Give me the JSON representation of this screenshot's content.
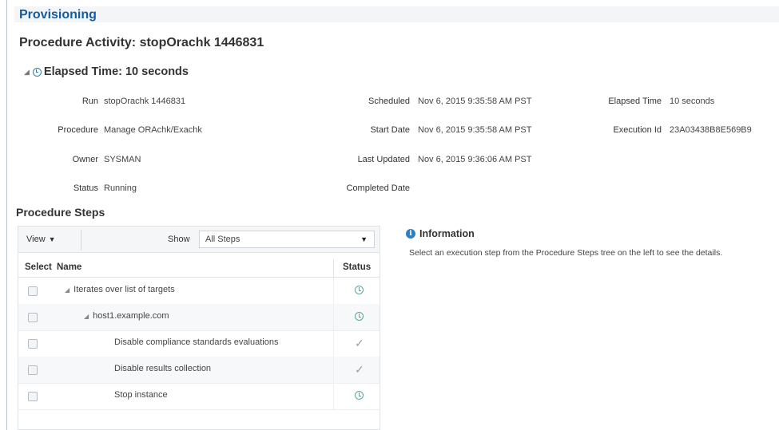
{
  "header": {
    "section_title": "Provisioning",
    "activity_title": "Procedure Activity: stopOrachk 1446831",
    "elapsed_heading": "Elapsed Time: 10 seconds"
  },
  "details": {
    "run": {
      "label": "Run",
      "value": "stopOrachk 1446831"
    },
    "procedure": {
      "label": "Procedure",
      "value": "Manage ORAchk/Exachk"
    },
    "owner": {
      "label": "Owner",
      "value": "SYSMAN"
    },
    "status": {
      "label": "Status",
      "value": "Running"
    },
    "scheduled": {
      "label": "Scheduled",
      "value": "Nov 6, 2015 9:35:58 AM PST"
    },
    "start_date": {
      "label": "Start Date",
      "value": "Nov 6, 2015 9:35:58 AM PST"
    },
    "last_updated": {
      "label": "Last Updated",
      "value": "Nov 6, 2015 9:36:06 AM PST"
    },
    "completed_date": {
      "label": "Completed Date",
      "value": ""
    },
    "elapsed_time": {
      "label": "Elapsed Time",
      "value": "10 seconds"
    },
    "execution_id": {
      "label": "Execution Id",
      "value": "23A03438B8E569B9"
    }
  },
  "steps": {
    "heading": "Procedure Steps",
    "toolbar": {
      "view_label": "View",
      "show_label": "Show",
      "show_value": "All Steps"
    },
    "columns": {
      "select": "Select",
      "name": "Name",
      "status": "Status"
    },
    "rows": [
      {
        "name": "Iterates over list of targets",
        "status_icon": "clock-icon"
      },
      {
        "name": "host1.example.com",
        "status_icon": "clock-icon"
      },
      {
        "name": "Disable compliance standards evaluations",
        "status_icon": "checkmark-icon"
      },
      {
        "name": "Disable results collection",
        "status_icon": "checkmark-icon"
      },
      {
        "name": "Stop instance",
        "status_icon": "clock-icon"
      }
    ]
  },
  "information": {
    "title": "Information",
    "text": "Select an execution step from the Procedure Steps tree on the left to see the details."
  },
  "colors": {
    "title_blue": "#145c9e",
    "clock_blue": "#1e85c8",
    "status_clock": "#5aa7a0",
    "info_blue": "#2d7fc1"
  }
}
